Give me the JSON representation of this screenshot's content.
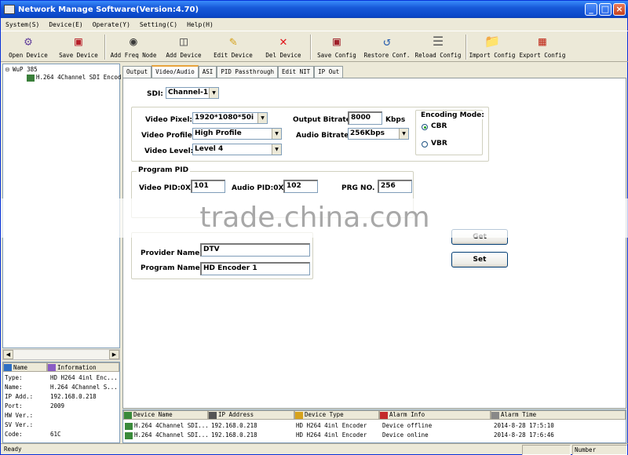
{
  "window": {
    "title": "Network Manage Software(Version:4.70)"
  },
  "menu": [
    "System(S)",
    "Device(E)",
    "Operate(Y)",
    "Setting(C)",
    "Help(H)"
  ],
  "toolbar": [
    {
      "label": "Open Device",
      "icon": "open-device-icon"
    },
    {
      "label": "Save Device",
      "icon": "save-device-icon"
    },
    {
      "label": "Add Freq Node",
      "icon": "add-freq-node-icon"
    },
    {
      "label": "Add Device",
      "icon": "add-device-icon"
    },
    {
      "label": "Edit Device",
      "icon": "edit-device-icon"
    },
    {
      "label": "Del Device",
      "icon": "delete-device-icon"
    },
    {
      "label": "Save Config",
      "icon": "save-config-icon"
    },
    {
      "label": "Restore Conf.",
      "icon": "restore-config-icon"
    },
    {
      "label": "Reload Config",
      "icon": "reload-config-icon"
    },
    {
      "label": "Import Config",
      "icon": "import-config-icon"
    },
    {
      "label": "Export Config",
      "icon": "export-config-icon"
    }
  ],
  "tree": {
    "root": "WuP 385",
    "child": "H.264 4Channel SDI Encod"
  },
  "info_panel": {
    "headers": [
      "Name",
      "Information"
    ],
    "rows": [
      {
        "k": "Type:",
        "v": "HD H264 4inl Enc..."
      },
      {
        "k": "Name:",
        "v": "H.264 4Channel S..."
      },
      {
        "k": "IP Add.:",
        "v": "192.168.0.218"
      },
      {
        "k": "Port:",
        "v": "2009"
      },
      {
        "k": "HW Ver.:",
        "v": ""
      },
      {
        "k": "SV Ver.:",
        "v": ""
      },
      {
        "k": "Code:",
        "v": "61C"
      }
    ]
  },
  "tabs": [
    "Output",
    "Video/Audio",
    "ASI",
    "PID Passthrough",
    "Edit NIT",
    "IP Out"
  ],
  "active_tab": "Video/Audio",
  "form": {
    "sdi_label": "SDI:",
    "sdi_value": "Channel-1",
    "video_pixel_label": "Video Pixel:",
    "video_pixel_value": "1920*1080*50i",
    "video_profile_label": "Video Profile:",
    "video_profile_value": "High Profile",
    "video_level_label": "Video Level:",
    "video_level_value": "Level 4",
    "output_bitrate_label": "Output Bitrate:",
    "output_bitrate_value": "8000",
    "output_bitrate_unit": "Kbps",
    "audio_bitrate_label": "Audio Bitrate:",
    "audio_bitrate_value": "256Kbps",
    "encoding_mode_label": "Encoding Mode:",
    "cbr_label": "CBR",
    "vbr_label": "VBR",
    "encoding_mode_selected": "CBR",
    "program_pid_title": "Program PID",
    "video_pid_label": "Video PID:0X",
    "video_pid_value": "101",
    "audio_pid_label": "Audio PID:0X",
    "audio_pid_value": "102",
    "prg_no_label": "PRG NO.",
    "prg_no_value": "256",
    "provider_name_label": "Provider Name:",
    "provider_name_value": "DTV",
    "program_name_label": "Program Name:",
    "program_name_value": "HD Encoder 1",
    "get_button": "Get",
    "set_button": "Set"
  },
  "watermark": "trade.china.com",
  "alarm": {
    "headers": [
      "Device Name",
      "IP Address",
      "Device Type",
      "Alarm Info",
      "Alarm Time"
    ],
    "rows": [
      [
        "H.264 4Channel SDI...",
        "192.168.0.218",
        "HD H264 4inl Encoder",
        "Device offline",
        "2014-8-28 17:5:10"
      ],
      [
        "H.264 4Channel SDI...",
        "192.168.0.218",
        "HD H264 4inl Encoder",
        "Device online",
        "2014-8-28 17:6:46"
      ]
    ]
  },
  "status": {
    "left": "Ready",
    "right": "Number"
  }
}
